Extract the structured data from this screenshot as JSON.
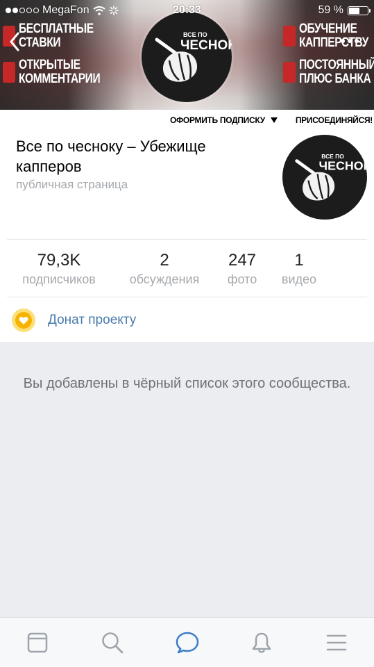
{
  "status_bar": {
    "carrier": "MegaFon",
    "time": "20:33",
    "battery": "59 %",
    "battery_level": 0.59
  },
  "cover": {
    "promos": [
      {
        "text": "БЕСПЛАТНЫЕ\nСТАВКИ"
      },
      {
        "text": "ОТКРЫТЫЕ\nКОММЕНТАРИИ"
      },
      {
        "text": "ОБУЧЕНИЕ\nКАППЕРСТВУ"
      },
      {
        "text": "ПОСТОЯННЫЙ\nПЛЮС БАНКА"
      }
    ],
    "logo_text_small": "ВСЕ ПО",
    "logo_text_big": "ЧЕСНОКУ"
  },
  "header": {
    "subscribe_label": "ОФОРМИТЬ ПОДПИСКУ",
    "join_label": "ПРИСОЕДИНЯЙСЯ!"
  },
  "group": {
    "name": "Все по чесноку – Убежище капперов",
    "type": "публичная страница"
  },
  "stats": [
    {
      "value": "79,3K",
      "label": "подписчиков"
    },
    {
      "value": "2",
      "label": "обсуждения"
    },
    {
      "value": "247",
      "label": "фото"
    },
    {
      "value": "1",
      "label": "видео"
    }
  ],
  "donate": {
    "label": "Донат проекту"
  },
  "blacklist_message": "Вы добавлены в чёрный список этого сообщества.",
  "tabbar": {
    "items": [
      {
        "icon": "news-feed-icon",
        "active": false
      },
      {
        "icon": "search-icon",
        "active": false
      },
      {
        "icon": "messages-icon",
        "active": true
      },
      {
        "icon": "notifications-bell-icon",
        "active": false
      },
      {
        "icon": "menu-icon",
        "active": false
      }
    ]
  },
  "colors": {
    "accent": "#4a7aac",
    "active_tab": "#3f7fc6",
    "inactive_tab": "#9ea4ab",
    "donate": "#f6b300"
  }
}
